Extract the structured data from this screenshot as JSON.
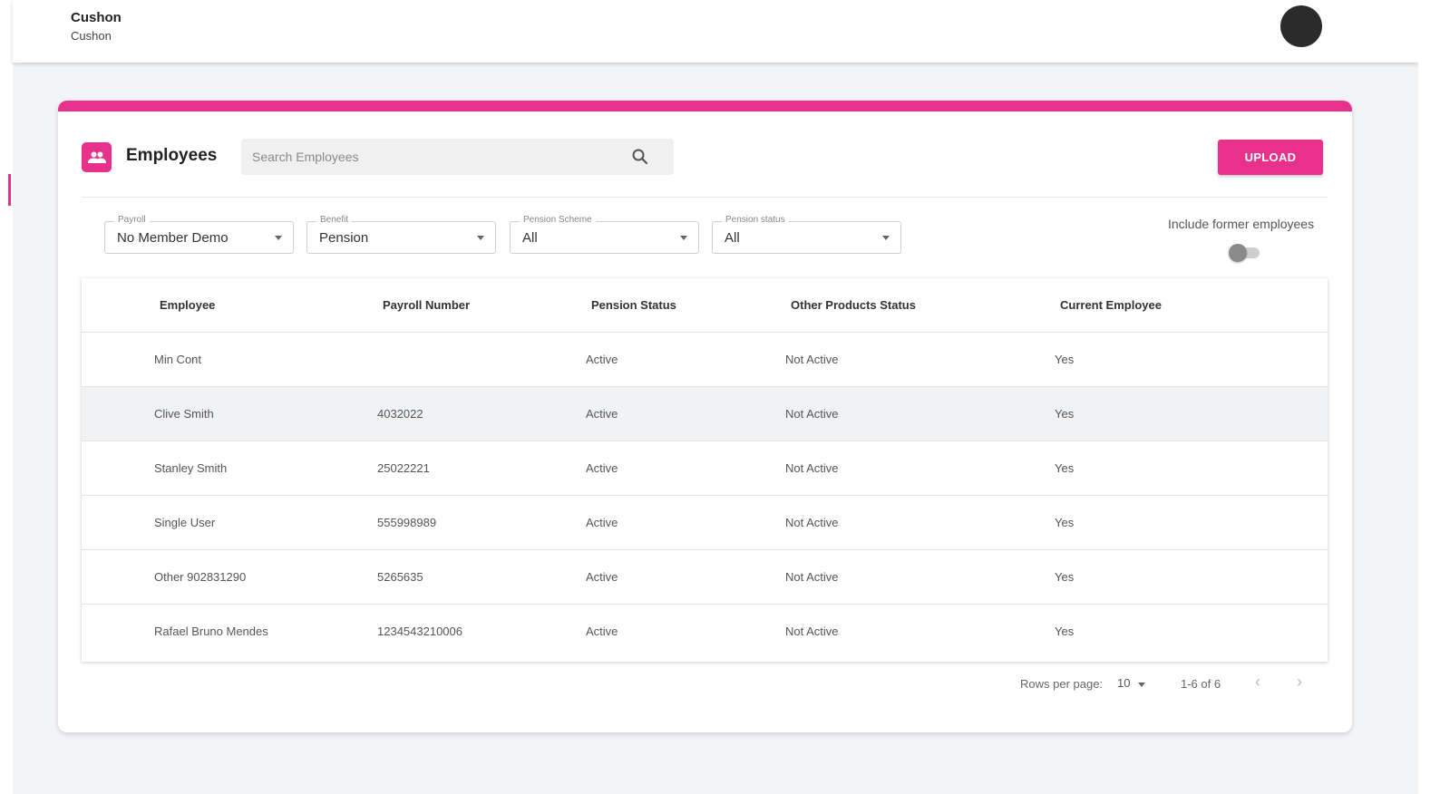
{
  "app": {
    "brand_title": "Cushon",
    "brand_subtitle": "Cushon",
    "avatar_icon": "user-avatar-icon"
  },
  "colors": {
    "accent": "#e8318a",
    "background": "#f3f4f6",
    "avatar": "#2b2b2b"
  },
  "employees": {
    "title": "Employees",
    "icon": "people-icon",
    "search_placeholder": "Search Employees",
    "search_icon": "search-icon",
    "upload_label": "UPLOAD"
  },
  "filters": [
    {
      "label": "Payroll",
      "value": "No Member Demo"
    },
    {
      "label": "Benefit",
      "value": "Pension"
    },
    {
      "label": "Pension Scheme",
      "value": "All"
    },
    {
      "label": "Pension status",
      "value": "All"
    }
  ],
  "former_toggle": {
    "label": "Include former employees",
    "on": false
  },
  "table": {
    "columns": [
      "Employee",
      "Payroll Number",
      "Pension Status",
      "Other Products Status",
      "Current Employee"
    ],
    "rows": [
      [
        "Min Cont",
        "",
        "Active",
        "Not Active",
        "Yes"
      ],
      [
        "Clive Smith",
        "4032022",
        "Active",
        "Not Active",
        "Yes"
      ],
      [
        "Stanley Smith",
        "25022221",
        "Active",
        "Not Active",
        "Yes"
      ],
      [
        "Single User",
        "555998989",
        "Active",
        "Not Active",
        "Yes"
      ],
      [
        "Other 902831290",
        "5265635",
        "Active",
        "Not Active",
        "Yes"
      ],
      [
        "Rafael Bruno Mendes",
        "1234543210006",
        "Active",
        "Not Active",
        "Yes"
      ]
    ]
  },
  "pagination": {
    "rows_per_page_label": "Rows per page:",
    "rows_per_page_value": "10",
    "range": "1-6 of 6",
    "prev_icon": "chevron-left-icon",
    "next_icon": "chevron-right-icon"
  }
}
